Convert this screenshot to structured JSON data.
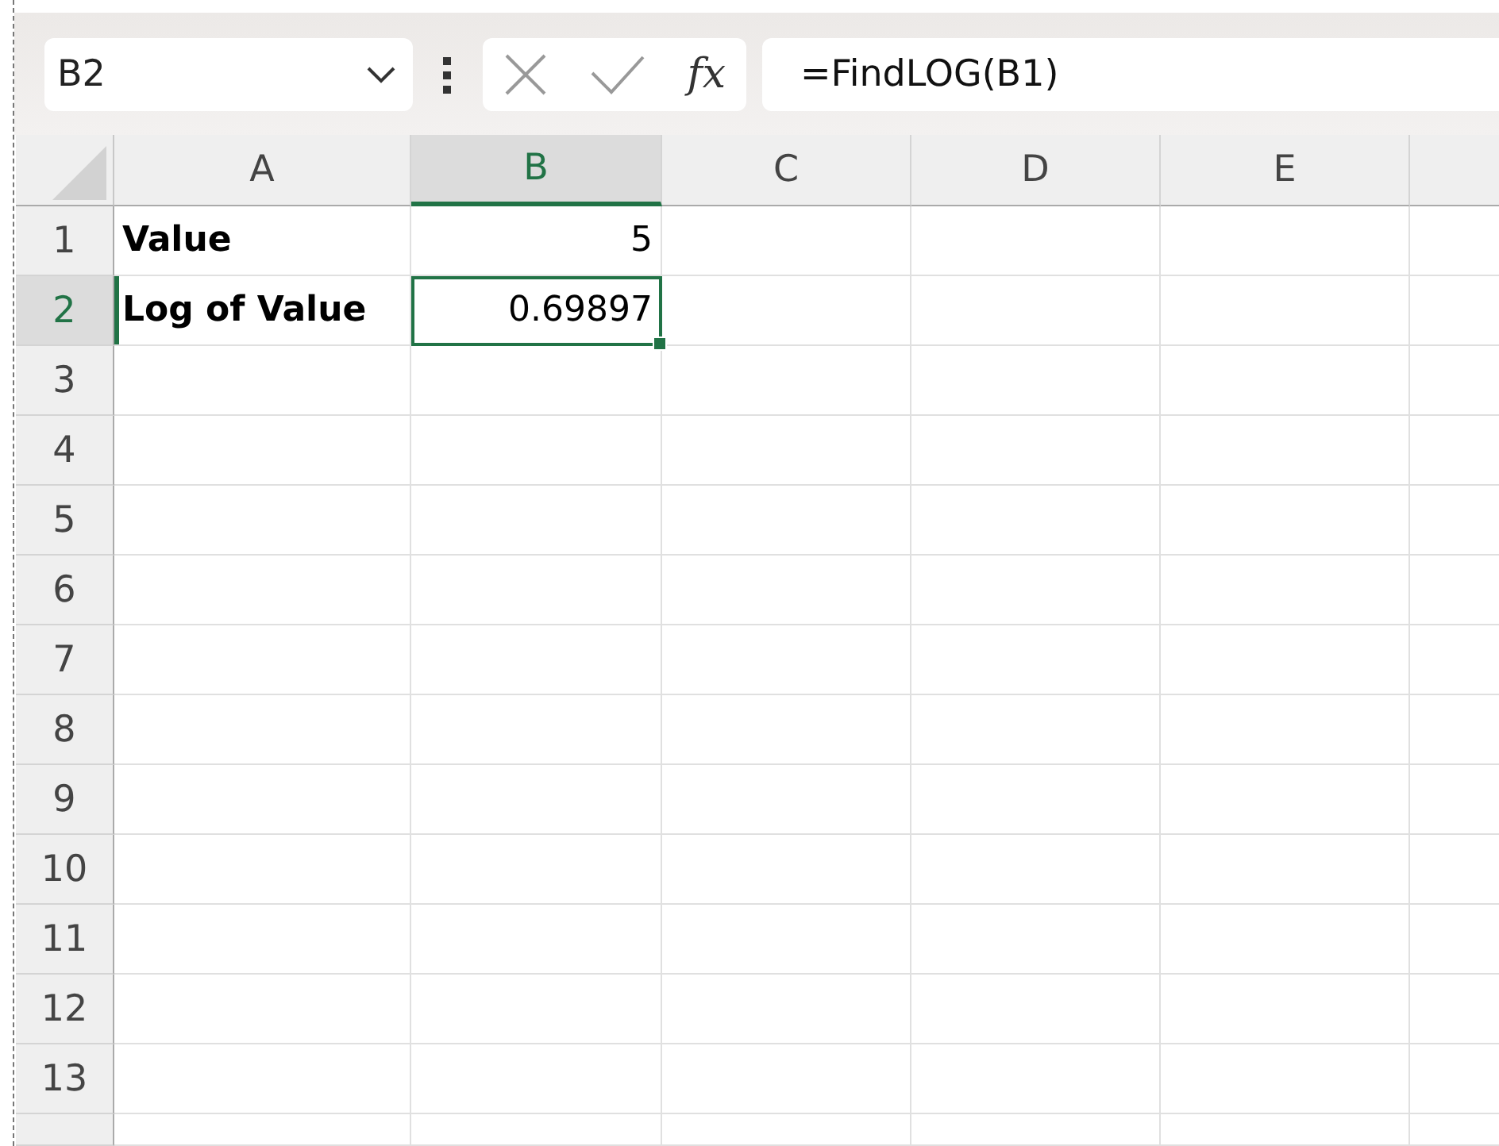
{
  "name_box": {
    "value": "B2"
  },
  "function_button": {
    "label": "fx"
  },
  "formula_bar": {
    "value": "=FindLOG(B1)"
  },
  "columns": [
    {
      "label": "A",
      "selected": false
    },
    {
      "label": "B",
      "selected": true
    },
    {
      "label": "C",
      "selected": false
    },
    {
      "label": "D",
      "selected": false
    },
    {
      "label": "E",
      "selected": false
    }
  ],
  "rows": [
    {
      "label": "1",
      "selected": false,
      "cells": [
        {
          "kind": "text",
          "text": "Value",
          "bold": true,
          "selected": false
        },
        {
          "kind": "number",
          "text": "5",
          "bold": false,
          "selected": false
        }
      ]
    },
    {
      "label": "2",
      "selected": true,
      "cells": [
        {
          "kind": "text",
          "text": "Log of Value",
          "bold": true,
          "selected": false
        },
        {
          "kind": "number",
          "text": "0.69897",
          "bold": false,
          "selected": true
        }
      ]
    },
    {
      "label": "3",
      "selected": false
    },
    {
      "label": "4",
      "selected": false
    },
    {
      "label": "5",
      "selected": false
    },
    {
      "label": "6",
      "selected": false
    },
    {
      "label": "7",
      "selected": false
    },
    {
      "label": "8",
      "selected": false
    },
    {
      "label": "9",
      "selected": false
    },
    {
      "label": "10",
      "selected": false
    },
    {
      "label": "11",
      "selected": false
    },
    {
      "label": "12",
      "selected": false
    },
    {
      "label": "13",
      "selected": false
    }
  ]
}
